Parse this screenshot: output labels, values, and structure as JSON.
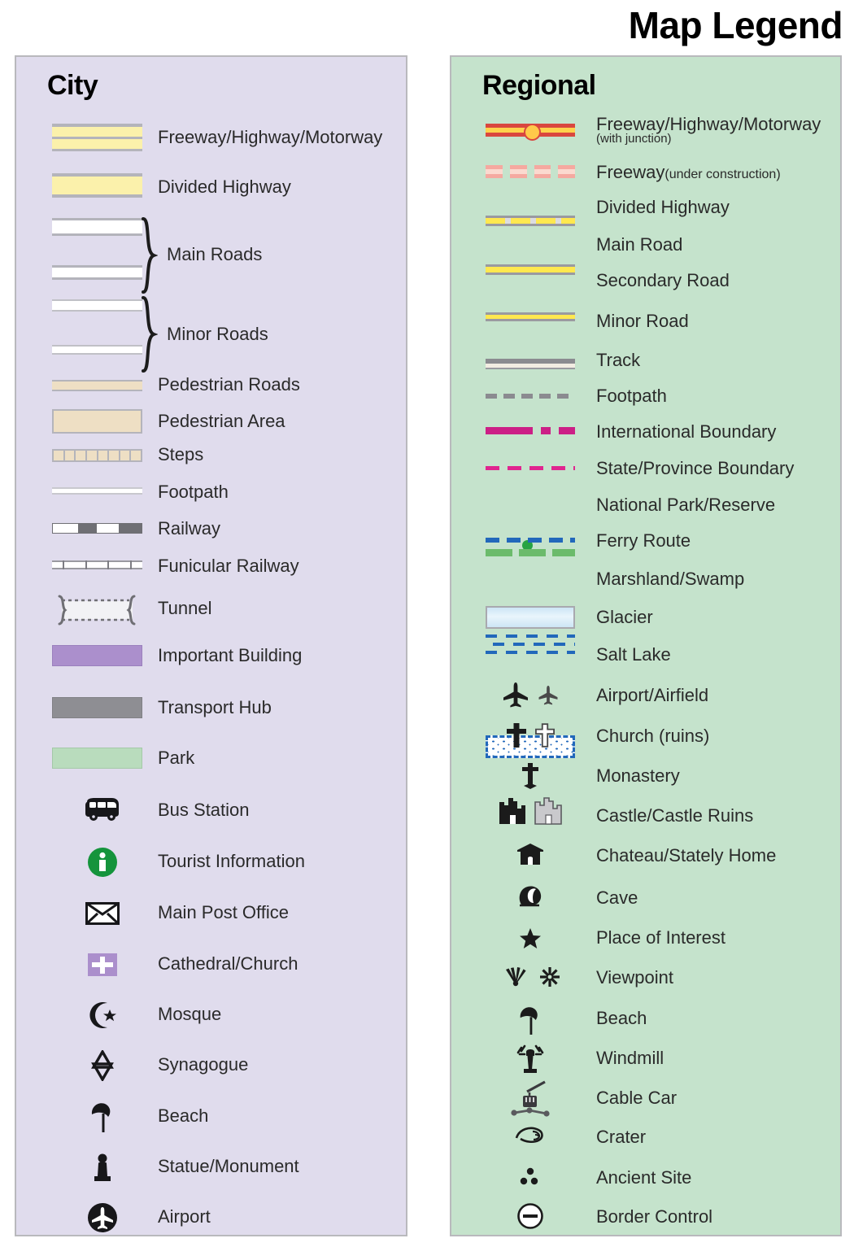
{
  "title": "Map Legend",
  "city": {
    "heading": "City",
    "items": [
      {
        "label": "Freeway/Highway/Motorway",
        "symbol": "city-freeway"
      },
      {
        "label": "Divided Highway",
        "symbol": "city-divided-highway"
      },
      {
        "label": "Main Roads",
        "symbol": "city-main-roads-braced"
      },
      {
        "label": "Minor Roads",
        "symbol": "city-minor-roads-braced"
      },
      {
        "label": "Pedestrian Roads",
        "symbol": "city-pedestrian-road"
      },
      {
        "label": "Pedestrian Area",
        "symbol": "city-pedestrian-area"
      },
      {
        "label": "Steps",
        "symbol": "city-steps"
      },
      {
        "label": "Footpath",
        "symbol": "city-footpath"
      },
      {
        "label": "Railway",
        "symbol": "city-railway"
      },
      {
        "label": "Funicular Railway",
        "symbol": "city-funicular-railway"
      },
      {
        "label": "Tunnel",
        "symbol": "city-tunnel"
      },
      {
        "label": "Important Building",
        "symbol": "city-important-building"
      },
      {
        "label": "Transport Hub",
        "symbol": "city-transport-hub"
      },
      {
        "label": "Park",
        "symbol": "city-park"
      },
      {
        "label": "Bus Station",
        "symbol": "bus-icon"
      },
      {
        "label": "Tourist Information",
        "symbol": "information-icon"
      },
      {
        "label": "Main Post Office",
        "symbol": "envelope-icon"
      },
      {
        "label": "Cathedral/Church",
        "symbol": "church-cross-icon"
      },
      {
        "label": "Mosque",
        "symbol": "crescent-star-icon"
      },
      {
        "label": "Synagogue",
        "symbol": "star-of-david-icon"
      },
      {
        "label": "Beach",
        "symbol": "beach-umbrella-icon"
      },
      {
        "label": "Statue/Monument",
        "symbol": "statue-icon"
      },
      {
        "label": "Airport",
        "symbol": "airport-circle-icon"
      }
    ]
  },
  "regional": {
    "heading": "Regional",
    "items": [
      {
        "label": "Freeway/Highway/Motorway",
        "sublabel": "(with junction)",
        "symbol": "regional-freeway-junction"
      },
      {
        "label": "Freeway",
        "sublabel": "(under construction)",
        "symbol": "regional-freeway-under-construction"
      },
      {
        "label": "Divided Highway",
        "symbol": "regional-divided-highway"
      },
      {
        "label": "Main Road",
        "symbol": "regional-main-road"
      },
      {
        "label": "Secondary Road",
        "symbol": "regional-secondary-road"
      },
      {
        "label": "Minor Road",
        "symbol": "regional-minor-road"
      },
      {
        "label": "Track",
        "symbol": "regional-track"
      },
      {
        "label": "Footpath",
        "symbol": "regional-footpath"
      },
      {
        "label": "International Boundary",
        "symbol": "international-boundary"
      },
      {
        "label": "State/Province Boundary",
        "symbol": "state-province-boundary"
      },
      {
        "label": "National Park/Reserve",
        "symbol": "national-park-line"
      },
      {
        "label": "Ferry Route",
        "symbol": "ferry-route-line"
      },
      {
        "label": "Marshland/Swamp",
        "symbol": "marshland-pattern"
      },
      {
        "label": "Glacier",
        "symbol": "glacier-swatch"
      },
      {
        "label": "Salt Lake",
        "symbol": "salt-lake-swatch"
      },
      {
        "label": "Airport/Airfield",
        "symbol": "airplane-icon"
      },
      {
        "label": "Church (ruins)",
        "symbol": "church-ruins-icon"
      },
      {
        "label": "Monastery",
        "symbol": "monastery-cross-icon"
      },
      {
        "label": "Castle/Castle Ruins",
        "symbol": "castle-icon"
      },
      {
        "label": "Chateau/Stately Home",
        "symbol": "chateau-icon"
      },
      {
        "label": "Cave",
        "symbol": "cave-icon"
      },
      {
        "label": "Place of Interest",
        "symbol": "star-icon"
      },
      {
        "label": "Viewpoint",
        "symbol": "viewpoint-icon"
      },
      {
        "label": "Beach",
        "symbol": "beach-umbrella-icon"
      },
      {
        "label": "Windmill",
        "symbol": "windmill-icon"
      },
      {
        "label": "Cable Car",
        "symbol": "cable-car-icon"
      },
      {
        "label": "Crater",
        "symbol": "crater-icon"
      },
      {
        "label": "Ancient Site",
        "symbol": "ancient-site-icon"
      },
      {
        "label": "Border Control",
        "symbol": "border-control-icon"
      }
    ]
  },
  "colors": {
    "city_panel_bg": "#e0dced",
    "regional_panel_bg": "#c5e3cc",
    "panel_border": "#b9b9bd",
    "road_yellow": "#fbf1ab",
    "regional_yellow": "#ffe84f",
    "freeway_red": "#d9473f",
    "boundary_magenta": "#cc1f86",
    "ferry_blue": "#2268bb",
    "park_green": "#b9dcbd",
    "important_building_purple": "#ab8fcc",
    "transport_hub_gray": "#8e8e93",
    "pedestrian_tan": "#eedfc4",
    "tourist_info_green": "#15943c"
  }
}
